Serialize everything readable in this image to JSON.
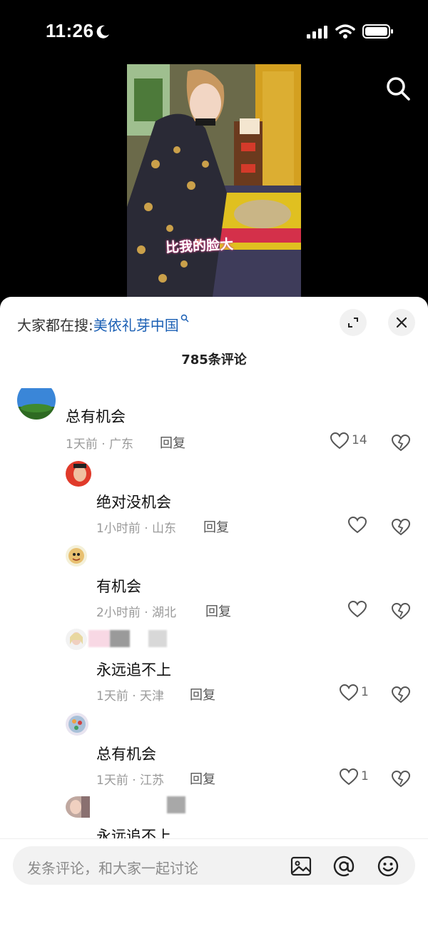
{
  "status": {
    "time": "11:26"
  },
  "video": {
    "subtitle": "比我的脸大"
  },
  "sheet": {
    "hot_search_label": "大家都在搜:",
    "hot_search_keyword": "美依礼芽中国",
    "comment_count": "785条评论"
  },
  "comments": [
    {
      "text": "总有机会",
      "meta": "1天前 · 广东",
      "reply": "回复",
      "likes": "14"
    },
    {
      "text": "绝对没机会",
      "meta": "1小时前 · 山东",
      "reply": "回复",
      "likes": ""
    },
    {
      "text": "有机会",
      "meta": "2小时前 · 湖北",
      "reply": "回复",
      "likes": ""
    },
    {
      "text": "永远追不上",
      "meta": "1天前 · 天津",
      "reply": "回复",
      "likes": "1"
    },
    {
      "text": "总有机会",
      "meta": "1天前 · 江苏",
      "reply": "回复",
      "likes": "1"
    },
    {
      "text": "永远追不上",
      "meta": "",
      "reply": "",
      "likes": ""
    }
  ],
  "input": {
    "placeholder": "发条评论，和大家一起讨论"
  },
  "icons": [
    "moon-icon",
    "signal-icon",
    "wifi-icon",
    "battery-icon",
    "search-icon",
    "expand-icon",
    "close-icon",
    "heart-icon",
    "broken-heart-icon",
    "image-icon",
    "at-icon",
    "emoji-icon"
  ]
}
